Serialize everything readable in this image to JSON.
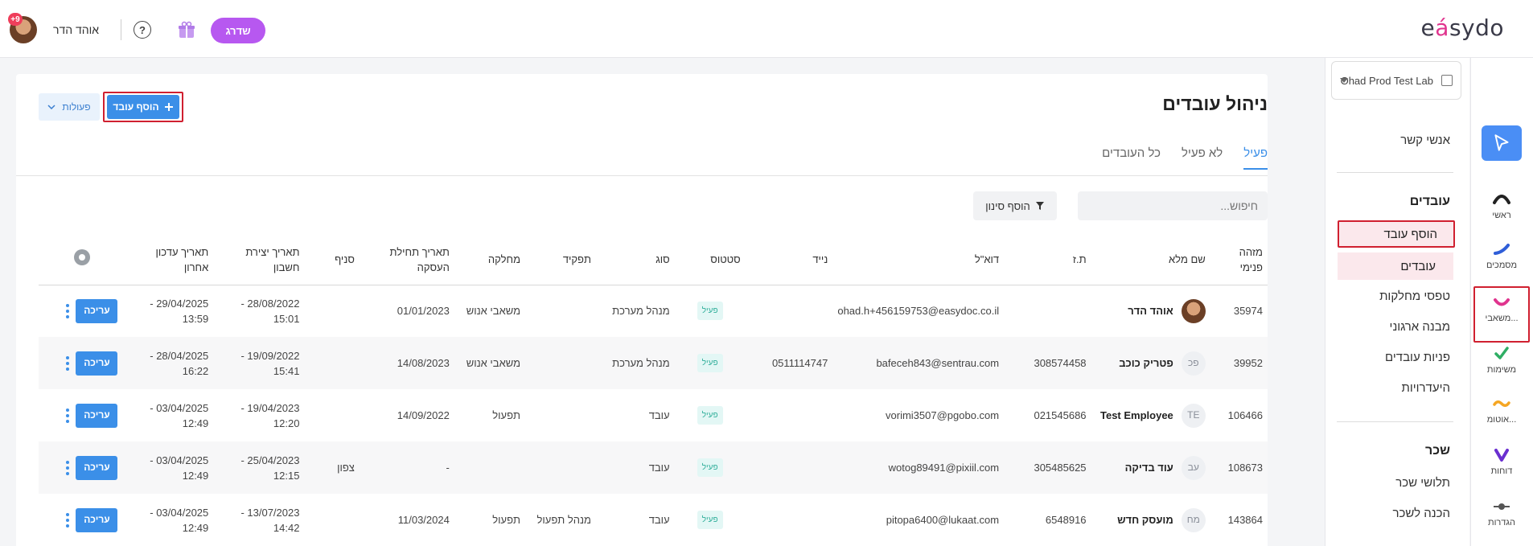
{
  "header": {
    "user_name": "אוהד הדר",
    "notif_count": "+9",
    "upgrade_label": "שדרג",
    "help_label": "?",
    "logo_text_1": "e",
    "logo_text_2": "á",
    "logo_text_3": "sydo"
  },
  "org": {
    "name": "Ohad Prod Test Lab"
  },
  "rail": {
    "items": [
      "ראשי",
      "מסמכים",
      "משאבי...",
      "משימות",
      "אוטומ...",
      "דוחות",
      "הגדרות"
    ]
  },
  "subnav": {
    "contacts": "אנשי קשר",
    "employees_section": "עובדים",
    "add_employee": "הוסף עובד",
    "employees": "עובדים",
    "dept_forms": "טפסי מחלקות",
    "org_structure": "מבנה ארגוני",
    "employee_requests": "פניות עובדים",
    "absences": "היעדרויות",
    "salary_section": "שכר",
    "payslips": "תלושי שכר",
    "salary_prep": "הכנה לשכר"
  },
  "main": {
    "title": "ניהול עובדים",
    "add_button": "הוסף עובד",
    "actions_button": "פעולות",
    "tabs": [
      "פעיל",
      "לא פעיל",
      "כל העובדים"
    ],
    "search_placeholder": "חיפוש...",
    "filter_button": "הוסף סינון"
  },
  "table": {
    "headers": {
      "id": "מזהה פנימי",
      "name": "שם מלא",
      "tz": "ת.ז",
      "email": "דוא\"ל",
      "mobile": "נייד",
      "status": "סטטוס",
      "type": "סוג",
      "role": "תפקיד",
      "dept": "מחלקה",
      "start": "תאריך תחילת העסקה",
      "branch": "סניף",
      "created": "תאריך יצירת חשבון",
      "updated": "תאריך עדכון אחרון"
    },
    "edit_label": "עריכה",
    "rows": [
      {
        "id": "35974",
        "initials": "",
        "name": "אוהד הדר",
        "tz": "",
        "email": "ohad.h+456159753@easydoc.co.il",
        "mobile": "",
        "status": "פעיל",
        "type": "מנהל מערכת",
        "role": "",
        "dept": "משאבי אנוש",
        "start": "01/01/2023",
        "branch": "",
        "created": "28/08/2022 - 15:01",
        "updated": "29/04/2025 - 13:59"
      },
      {
        "id": "39952",
        "initials": "פכ",
        "name": "פטריק כוכב",
        "tz": "308574458",
        "email": "bafeceh843@sentrau.com",
        "mobile": "0511114747",
        "status": "פעיל",
        "type": "מנהל מערכת",
        "role": "",
        "dept": "משאבי אנוש",
        "start": "14/08/2023",
        "branch": "",
        "created": "19/09/2022 - 15:41",
        "updated": "28/04/2025 - 16:22"
      },
      {
        "id": "106466",
        "initials": "TE",
        "name": "Test Employee",
        "tz": "021545686",
        "email": "vorimi3507@pgobo.com",
        "mobile": "",
        "status": "פעיל",
        "type": "עובד",
        "role": "",
        "dept": "תפעול",
        "start": "14/09/2022",
        "branch": "",
        "created": "19/04/2023 - 12:20",
        "updated": "03/04/2025 - 12:49"
      },
      {
        "id": "108673",
        "initials": "עב",
        "name": "עוד בדיקה",
        "tz": "305485625",
        "email": "wotog89491@pixiil.com",
        "mobile": "",
        "status": "פעיל",
        "type": "עובד",
        "role": "",
        "dept": "",
        "start": "-",
        "branch": "צפון",
        "created": "25/04/2023 - 12:15",
        "updated": "03/04/2025 - 12:49"
      },
      {
        "id": "143864",
        "initials": "מח",
        "name": "מועסק חדש",
        "tz": "6548916",
        "email": "pitopa6400@lukaat.com",
        "mobile": "",
        "status": "פעיל",
        "type": "עובד",
        "role": "מנהל תפעול",
        "dept": "תפעול",
        "start": "11/03/2024",
        "branch": "",
        "created": "13/07/2023 - 14:42",
        "updated": "03/04/2025 - 12:49"
      }
    ]
  },
  "colors": {
    "accent": "#3b8fe8",
    "upgrade": "#b758f0",
    "highlight": "#d02030",
    "status_bg": "#e3f7f5"
  },
  "icons": [
    "gift-icon",
    "help-icon",
    "cursor-icon",
    "building-icon",
    "filter-icon",
    "plus-icon",
    "chevron-down-icon",
    "gear-icon",
    "kebab-icon"
  ]
}
